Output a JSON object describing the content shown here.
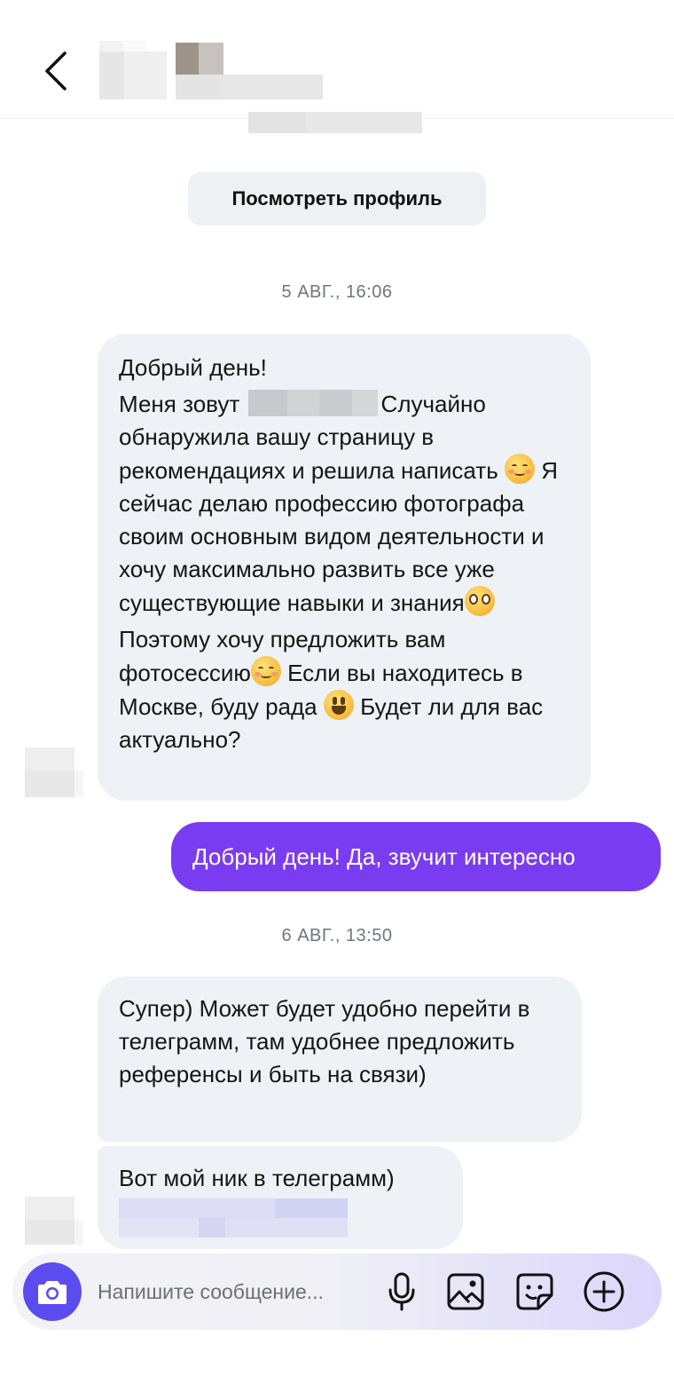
{
  "header": {
    "back_icon": "chevron-left-icon"
  },
  "profile_button": {
    "label": "Посмотреть профиль"
  },
  "messages": {
    "date1": "5 АВГ., 16:06",
    "msg1": {
      "line1": "Добрый день!",
      "line2_a": "Меня зовут",
      "line2_b": "Случайно обнаружила вашу страницу в рекомендациях и решила написать",
      "line3": "Я сейчас делаю профессию фотографа своим основным видом деятельности и хочу максимально развить все уже существующие навыки и знания",
      "line4_a": "Поэтому хочу предложить вам фотосессию",
      "line4_b": "Если вы находитесь в Москве, буду рада",
      "line4_c": "Будет ли для вас актуально?"
    },
    "reply1": "Добрый день! Да, звучит интересно",
    "date2": "6 АВГ., 13:50",
    "msg2": "Супер) Может будет удобно перейти в телеграмм, там удобнее предложить референсы и быть на связи)",
    "msg3": "Вот мой ник в телеграмм)"
  },
  "composer": {
    "placeholder": "Напишите сообщение...",
    "camera_icon": "camera-icon",
    "mic_icon": "microphone-icon",
    "gallery_icon": "image-icon",
    "sticker_icon": "sticker-icon",
    "plus_icon": "plus-circle-icon"
  },
  "colors": {
    "accent": "#7a3cf0",
    "camera_button": "#5b4cf0",
    "incoming_bubble": "#eef1f5",
    "date_text": "#6f7680"
  }
}
